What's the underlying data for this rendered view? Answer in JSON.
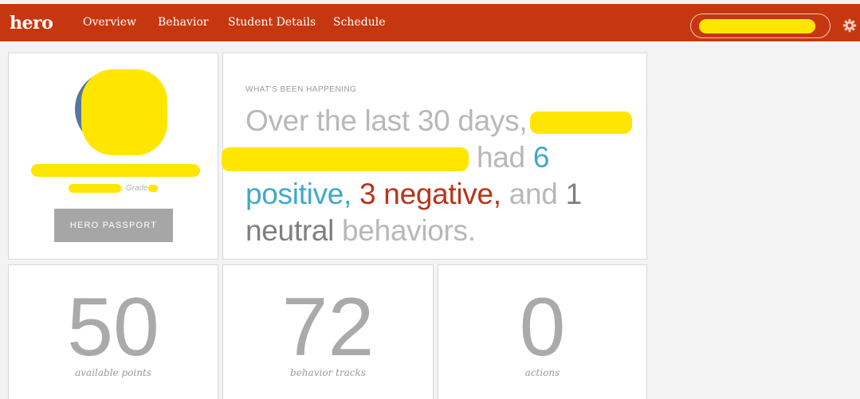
{
  "topbar": {
    "brand": "hero",
    "nav": [
      "Overview",
      "Behavior",
      "Student Details",
      "Schedule"
    ],
    "icons": {
      "settings": "gear-icon"
    },
    "accent_color": "#c7370f"
  },
  "profile": {
    "grade_label": ", Grade",
    "passport_button": "HERO PASSPORT"
  },
  "happening": {
    "kicker": "WHAT'S BEEN HAPPENING",
    "intro": "Over the last 30 days,",
    "had": "had",
    "positive_count": "6",
    "positive_word": "positive,",
    "negative_count": "3",
    "negative_word": "negative,",
    "and_text": "and",
    "neutral_count": "1",
    "neutral_word": "neutral",
    "behaviors_text": "behaviors.",
    "colors": {
      "positive": "#3fa9c9",
      "negative": "#b9341b",
      "neutral": "#7f7f7f"
    }
  },
  "stats": [
    {
      "value": "50",
      "label": "available points"
    },
    {
      "value": "72",
      "label": "behavior tracks"
    },
    {
      "value": "0",
      "label": "actions"
    }
  ]
}
